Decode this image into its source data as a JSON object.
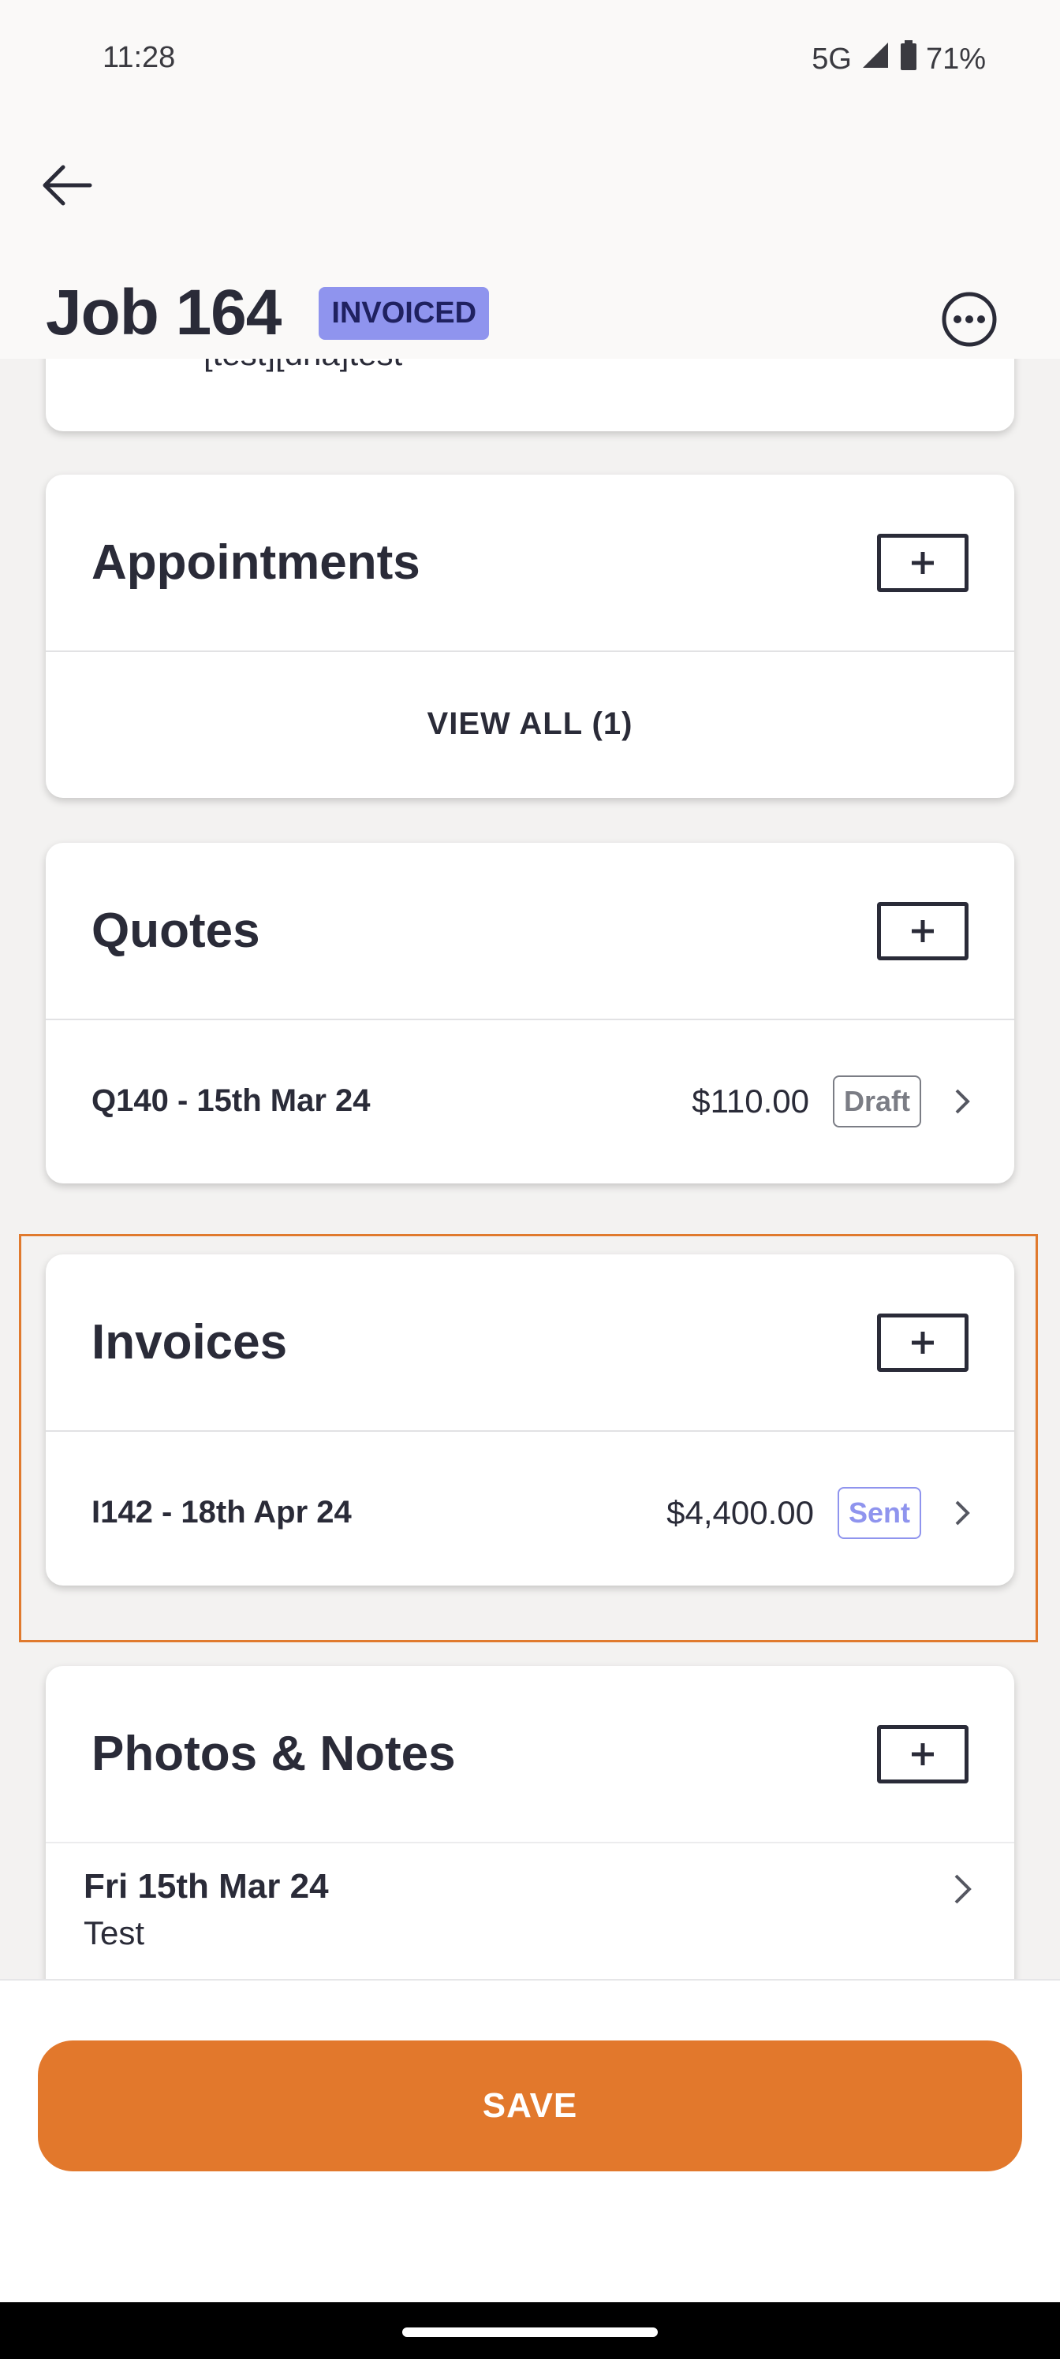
{
  "status_bar": {
    "time": "11:28",
    "network": "5G",
    "battery": "71%"
  },
  "header": {
    "title": "Job 164",
    "status": "INVOICED"
  },
  "top_card": {
    "text": "[test][dna]test"
  },
  "appointments": {
    "title": "Appointments",
    "view_all": "VIEW ALL (1)"
  },
  "quotes": {
    "title": "Quotes",
    "items": [
      {
        "label": "Q140 - 15th Mar 24",
        "amount": "$110.00",
        "status": "Draft"
      }
    ]
  },
  "invoices": {
    "title": "Invoices",
    "items": [
      {
        "label": "I142 - 18th Apr 24",
        "amount": "$4,400.00",
        "status": "Sent"
      }
    ]
  },
  "photos_notes": {
    "title": "Photos & Notes",
    "items": [
      {
        "date": "Fri 15th Mar 24",
        "text": "Test"
      }
    ]
  },
  "footer": {
    "save_label": "SAVE"
  },
  "colors": {
    "accent": "#e2782c",
    "badge": "#8f94ee",
    "text": "#2a2b38"
  }
}
